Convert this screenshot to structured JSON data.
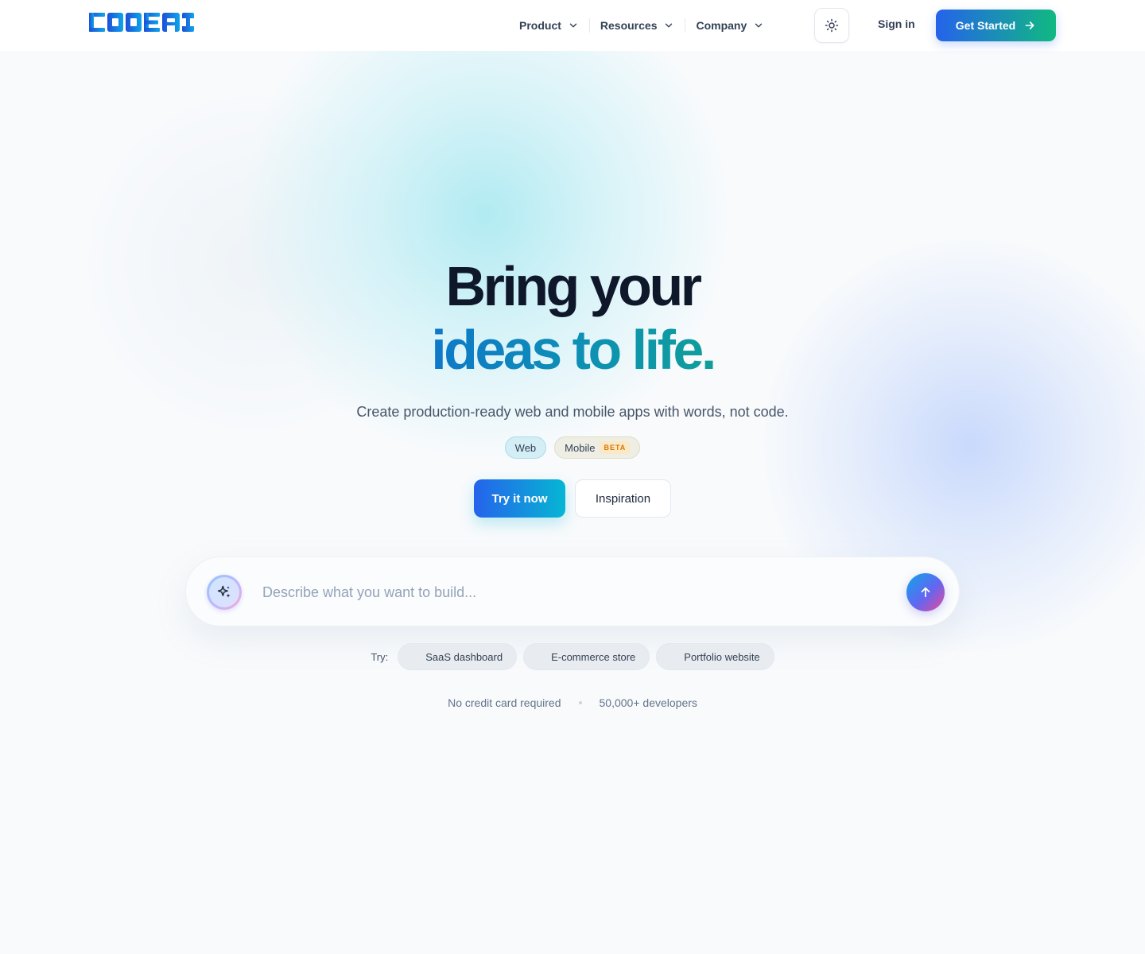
{
  "brand": {
    "logo_text": "CODEAI",
    "logo_color": "#1d4ed8"
  },
  "nav": {
    "items": [
      {
        "label": "Product",
        "icon": "chevron-down-icon"
      },
      {
        "label": "Resources",
        "icon": "chevron-down-icon"
      },
      {
        "label": "Company",
        "icon": "chevron-down-icon"
      }
    ],
    "theme_icon": "sun-icon",
    "sign_in": "Sign in",
    "get_started": "Get Started",
    "get_started_icon": "arrow-right-icon"
  },
  "hero": {
    "title_line1": "Bring your",
    "title_line2": "ideas to life.",
    "subtitle": "Create production-ready web and mobile apps with words, not code.",
    "badges": [
      {
        "label": "Web"
      },
      {
        "label": "Mobile",
        "tag": "BETA"
      }
    ],
    "primary_cta": "Try it now",
    "secondary_cta": "Inspiration"
  },
  "prompt": {
    "placeholder": "Describe what you want to build...",
    "value": "",
    "left_icon": "sparkles-icon",
    "send_icon": "arrow-up-icon"
  },
  "suggestions": {
    "label": "Try:",
    "chips": [
      "SaaS dashboard",
      "E-commerce store",
      "Portfolio website"
    ]
  },
  "footer_note": {
    "left": "No credit card required",
    "right": "50,000+ developers"
  },
  "colors": {
    "title_dark": "#0f172a",
    "accent_blue": "#2563eb",
    "accent_teal": "#10b981",
    "accent_cyan": "#06b6d4",
    "beta_orange": "#d97706"
  }
}
